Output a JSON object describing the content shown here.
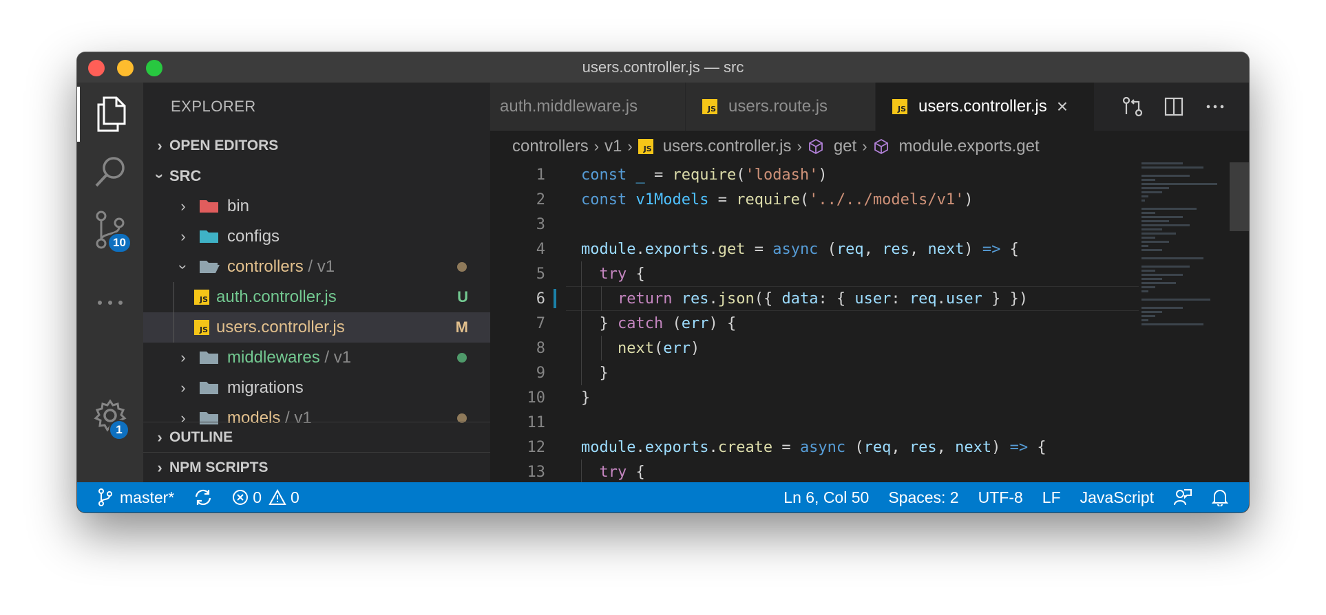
{
  "window": {
    "title": "users.controller.js — src"
  },
  "activity": {
    "source_control_badge": "10",
    "settings_badge": "1"
  },
  "sidebar": {
    "title": "EXPLORER",
    "open_editors": "OPEN EDITORS",
    "root": "SRC",
    "items": [
      {
        "name": "bin",
        "type": "folder",
        "color": "#cccccc",
        "icon_color": "#e05d5d"
      },
      {
        "name": "configs",
        "type": "folder",
        "color": "#cccccc",
        "icon_color": "#3fb2c6"
      },
      {
        "name": "controllers",
        "suffix": " / v1",
        "type": "folder-open",
        "color": "#e2c08d",
        "icon_color": "#90a4ae"
      },
      {
        "name": "auth.controller.js",
        "type": "js",
        "color": "#73c991",
        "status": "U"
      },
      {
        "name": "users.controller.js",
        "type": "js",
        "color": "#e2c08d",
        "status": "M"
      },
      {
        "name": "middlewares",
        "suffix": " / v1",
        "type": "folder",
        "color": "#73c991",
        "icon_color": "#90a4ae"
      },
      {
        "name": "migrations",
        "type": "folder",
        "color": "#cccccc",
        "icon_color": "#90a4ae"
      },
      {
        "name": "models",
        "suffix": " / v1",
        "type": "folder",
        "color": "#e2c08d",
        "icon_color": "#90a4ae"
      }
    ],
    "outline": "OUTLINE",
    "npm_scripts": "NPM SCRIPTS"
  },
  "tabs": [
    {
      "label": "auth.middleware.js",
      "active": false,
      "icon": false
    },
    {
      "label": "users.route.js",
      "active": false,
      "icon": true
    },
    {
      "label": "users.controller.js",
      "active": true,
      "icon": true
    }
  ],
  "breadcrumbs": {
    "folder1": "controllers",
    "folder2": "v1",
    "file": "users.controller.js",
    "symbol1": "get",
    "symbol2": "module.exports.get"
  },
  "code": {
    "line_numbers": [
      "1",
      "2",
      "3",
      "4",
      "5",
      "6",
      "7",
      "8",
      "9",
      "10",
      "11",
      "12",
      "13"
    ],
    "current_line": 6
  },
  "status": {
    "branch": "master*",
    "errors": "0",
    "warnings": "0",
    "position": "Ln 6, Col 50",
    "spaces": "Spaces: 2",
    "encoding": "UTF-8",
    "eol": "LF",
    "language": "JavaScript"
  },
  "colors": {
    "accent": "#007acc",
    "badge": "#0e70c0"
  }
}
